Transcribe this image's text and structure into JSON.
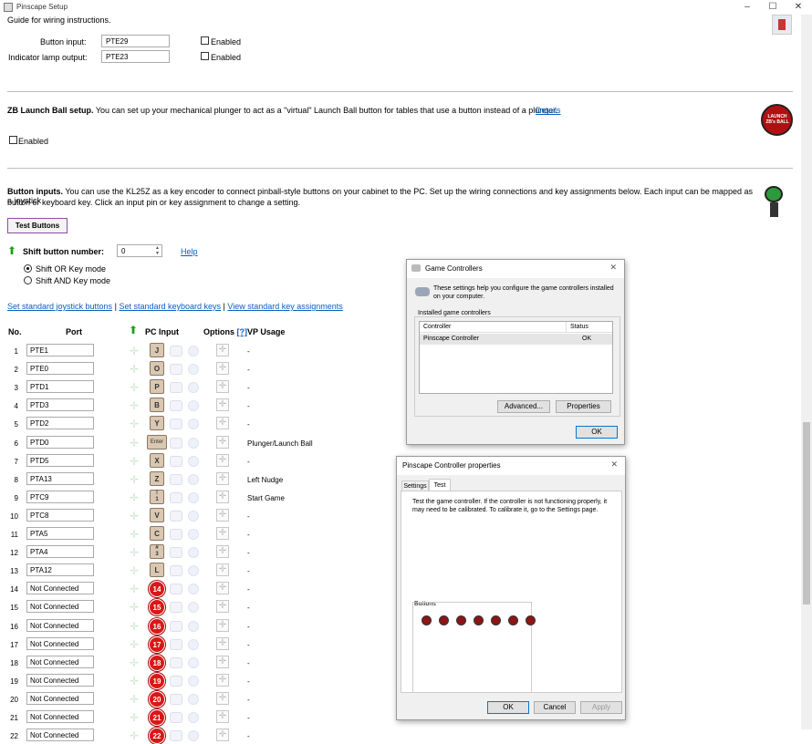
{
  "window": {
    "title": "Pinscape Setup",
    "controls": [
      "–",
      "☐",
      "✕"
    ]
  },
  "top": {
    "guide_text": "Guide for wiring instructions.",
    "button_input_label": "Button input:",
    "button_input_value": "PTE29",
    "indicator_label": "Indicator lamp output:",
    "indicator_value": "PTE23",
    "enabled": "Enabled"
  },
  "zb": {
    "title": "ZB Launch Ball setup.",
    "desc": " You can set up your mechanical plunger to act as a \"virtual\" Launch Ball button for tables that use a button instead of a plunger.",
    "details": "Details",
    "enabled": "Enabled",
    "logo_text": "LAUNCH ZB's BALL"
  },
  "buttons": {
    "title": "Button inputs.",
    "desc1": " You can use the KL25Z as a key encoder to connect pinball-style buttons on your cabinet to the PC. Set up the wiring connections and key assignments below. Each input can be mapped as a joystick",
    "desc2": "button or keyboard key. Click an input pin or key assignment to change a setting.",
    "test_button": "Test Buttons",
    "shift_label": "Shift button number:",
    "shift_value": "0",
    "help": "Help",
    "radio1": "Shift OR Key mode",
    "radio2": "Shift AND Key mode",
    "link1": "Set standard joystick buttons",
    "link2": "Set standard keyboard keys",
    "link3": "View standard key assignments",
    "sep": "|",
    "col_no": "No.",
    "col_port": "Port",
    "col_pc": "PC Input",
    "col_options": "Options",
    "col_options_help": "[?]",
    "col_vp": "VP Usage",
    "rows": [
      {
        "n": "1",
        "port": "PTE1",
        "key": "J",
        "vp": "-"
      },
      {
        "n": "2",
        "port": "PTE0",
        "key": "O",
        "vp": "-"
      },
      {
        "n": "3",
        "port": "PTD1",
        "key": "P",
        "vp": "-"
      },
      {
        "n": "4",
        "port": "PTD3",
        "key": "B",
        "vp": "-"
      },
      {
        "n": "5",
        "port": "PTD2",
        "key": "Y",
        "vp": "-"
      },
      {
        "n": "6",
        "port": "PTD0",
        "key": "Enter",
        "vp": "Plunger/Launch Ball"
      },
      {
        "n": "7",
        "port": "PTD5",
        "key": "X",
        "vp": "-"
      },
      {
        "n": "8",
        "port": "PTA13",
        "key": "Z",
        "vp": "Left Nudge"
      },
      {
        "n": "9",
        "port": "PTC9",
        "key": "!\n1",
        "vp": "Start Game"
      },
      {
        "n": "10",
        "port": "PTC8",
        "key": "V",
        "vp": "-"
      },
      {
        "n": "11",
        "port": "PTA5",
        "key": "C",
        "vp": "-"
      },
      {
        "n": "12",
        "port": "PTA4",
        "key": "#\n3",
        "vp": "-"
      },
      {
        "n": "13",
        "port": "PTA12",
        "key": "L",
        "vp": "-"
      },
      {
        "n": "14",
        "port": "Not Connected",
        "key": "14",
        "vp": "-"
      },
      {
        "n": "15",
        "port": "Not Connected",
        "key": "15",
        "vp": "-"
      },
      {
        "n": "16",
        "port": "Not Connected",
        "key": "16",
        "vp": "-"
      },
      {
        "n": "17",
        "port": "Not Connected",
        "key": "17",
        "vp": "-"
      },
      {
        "n": "18",
        "port": "Not Connected",
        "key": "18",
        "vp": "-"
      },
      {
        "n": "19",
        "port": "Not Connected",
        "key": "19",
        "vp": "-"
      },
      {
        "n": "20",
        "port": "Not Connected",
        "key": "20",
        "vp": "-"
      },
      {
        "n": "21",
        "port": "Not Connected",
        "key": "21",
        "vp": "-"
      },
      {
        "n": "22",
        "port": "Not Connected",
        "key": "22",
        "vp": "-"
      }
    ]
  },
  "game_controllers": {
    "title": "Game Controllers",
    "intro": "These settings help you configure the game controllers installed on your computer.",
    "group": "Installed game controllers",
    "col_controller": "Controller",
    "col_status": "Status",
    "controller_name": "Pinscape Controller",
    "controller_status": "OK",
    "advanced": "Advanced...",
    "properties": "Properties",
    "ok": "OK"
  },
  "props": {
    "title": "Pinscape Controller properties",
    "tab_settings": "Settings",
    "tab_test": "Test",
    "text": "Test the game controller.  If the controller is not functioning properly, it may need to be calibrated.  To calibrate it, go to the Settings page.",
    "buttons_group": "Buttons",
    "ok": "OK",
    "cancel": "Cancel",
    "apply": "Apply"
  }
}
